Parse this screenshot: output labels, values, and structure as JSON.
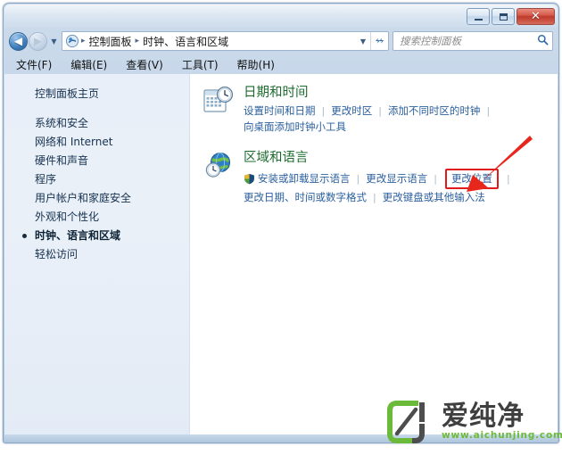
{
  "window": {
    "caption_buttons": [
      {
        "name": "minimize",
        "tooltip": "最小化"
      },
      {
        "name": "maximize",
        "tooltip": "最大化"
      },
      {
        "name": "close",
        "glyph": "✕",
        "tooltip": "关闭"
      }
    ]
  },
  "navbar": {
    "back_glyph": "◀",
    "forward_glyph": "▶",
    "history_glyph": "▼",
    "breadcrumb_icon": "control-panel-icon",
    "breadcrumbs": [
      "控制面板",
      "时钟、语言和区域"
    ],
    "separator": "▸",
    "dropdown_glyph": "▼",
    "refresh_glyph": "↯"
  },
  "search": {
    "placeholder": "搜索控制面板",
    "icon": "search-icon"
  },
  "menubar": {
    "items": [
      "文件(F)",
      "编辑(E)",
      "查看(V)",
      "工具(T)",
      "帮助(H)"
    ]
  },
  "sidebar": {
    "home": "控制面板主页",
    "items": [
      {
        "label": "系统和安全",
        "active": false
      },
      {
        "label": "网络和 Internet",
        "active": false
      },
      {
        "label": "硬件和声音",
        "active": false
      },
      {
        "label": "程序",
        "active": false
      },
      {
        "label": "用户帐户和家庭安全",
        "active": false
      },
      {
        "label": "外观和个性化",
        "active": false
      },
      {
        "label": "时钟、语言和区域",
        "active": true
      },
      {
        "label": "轻松访问",
        "active": false
      }
    ]
  },
  "main": {
    "categories": [
      {
        "icon": "date-time-icon",
        "title": "日期和时间",
        "rows": [
          [
            {
              "label": "设置时间和日期",
              "shield": false,
              "highlighted": false
            },
            {
              "label": "更改时区",
              "shield": false,
              "highlighted": false
            },
            {
              "label": "添加不同时区的时钟",
              "shield": false,
              "highlighted": false
            }
          ],
          [
            {
              "label": "向桌面添加时钟小工具",
              "shield": false,
              "highlighted": false
            }
          ]
        ]
      },
      {
        "icon": "region-language-icon",
        "title": "区域和语言",
        "rows": [
          [
            {
              "label": "安装或卸载显示语言",
              "shield": true,
              "highlighted": false
            },
            {
              "label": "更改显示语言",
              "shield": false,
              "highlighted": false
            },
            {
              "label": "更改位置",
              "shield": false,
              "highlighted": true
            }
          ],
          [
            {
              "label": "更改日期、时间或数字格式",
              "shield": false,
              "highlighted": false
            },
            {
              "label": "更改键盘或其他输入法",
              "shield": false,
              "highlighted": false
            }
          ]
        ]
      }
    ],
    "divider": "|"
  },
  "annotation": {
    "arrow_color": "#e8271c",
    "highlight_color": "#e01b1b",
    "points_to": "更改位置"
  },
  "watermark": {
    "title": "爱纯净",
    "url": "www.aichunjing.com",
    "logo_color": "#6cba3a",
    "logo_dark": "#4d4d4d"
  }
}
